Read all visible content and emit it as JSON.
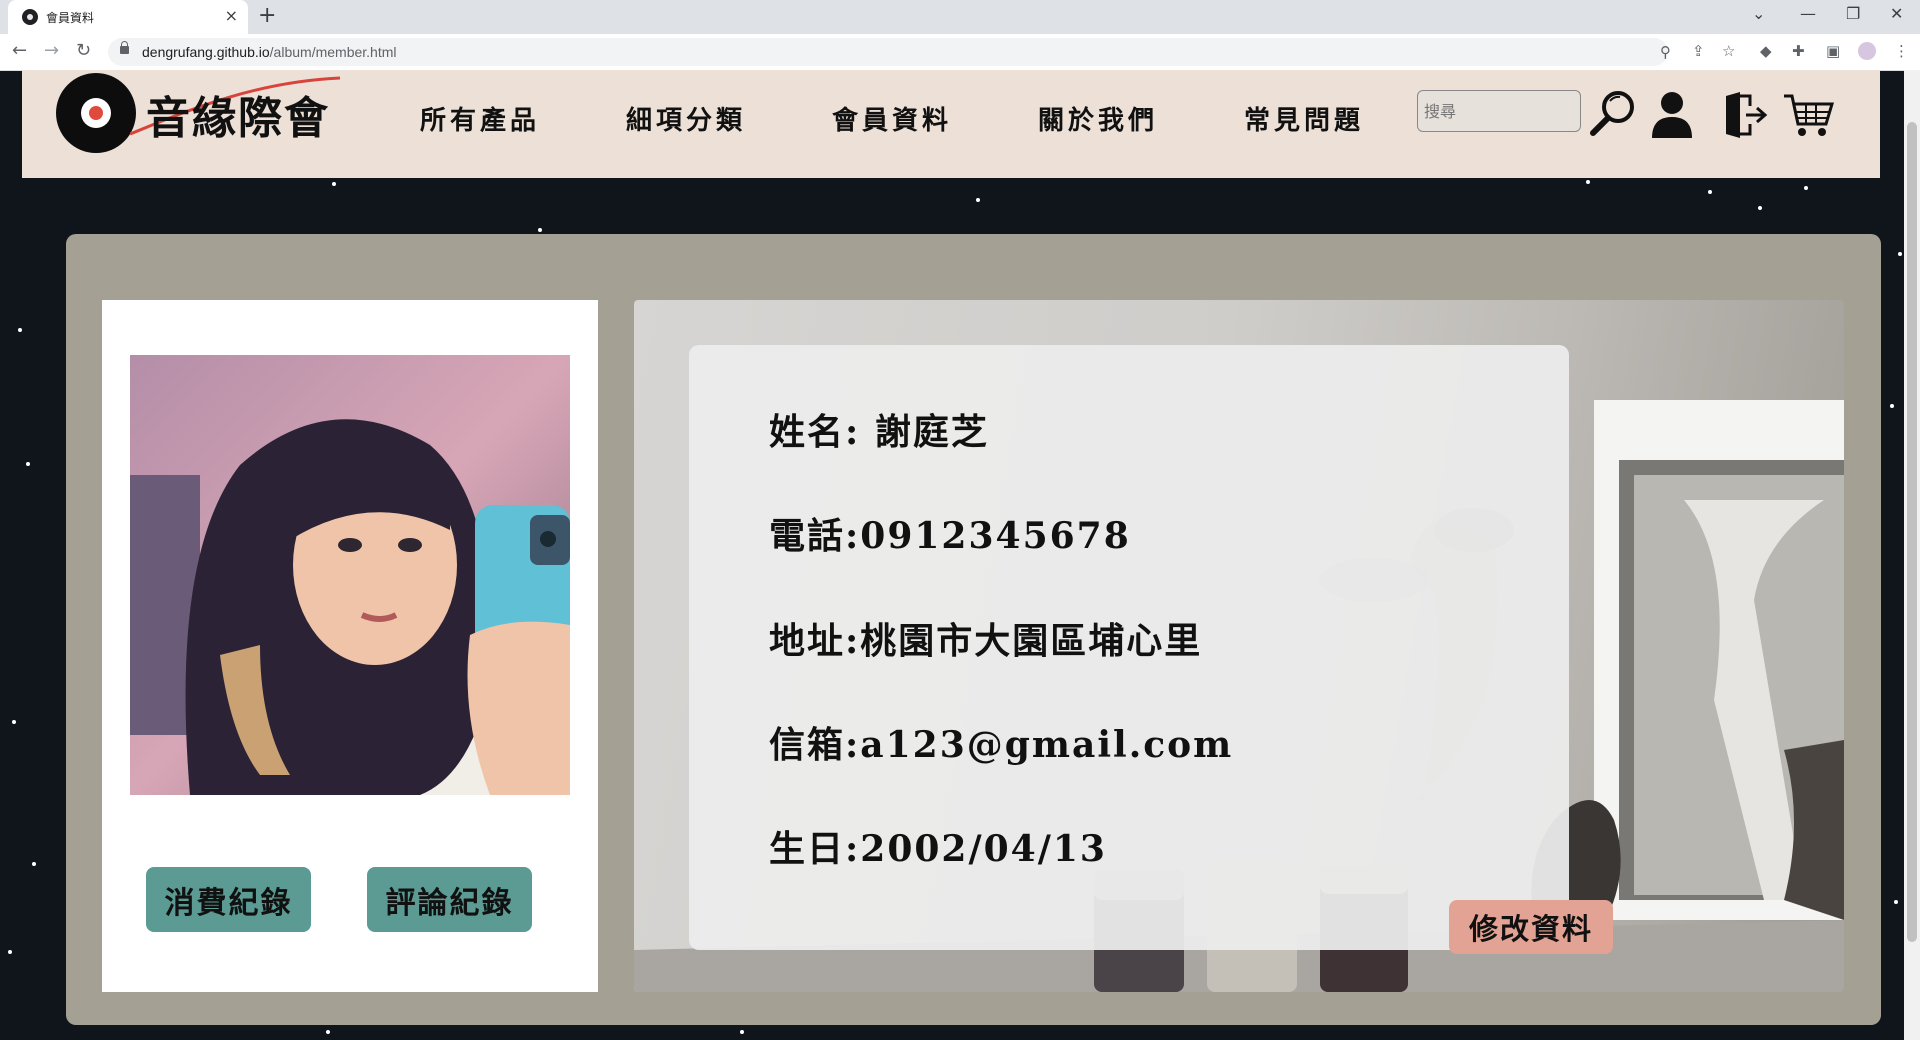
{
  "browser": {
    "tab_title": "會員資料",
    "tab_close": "×",
    "new_tab": "+",
    "url_host": "dengrufang.github.io",
    "url_path": "/album/member.html"
  },
  "header": {
    "logo_text": "音緣際會",
    "nav": [
      "所有產品",
      "細項分類",
      "會員資料",
      "關於我們",
      "常見問題"
    ],
    "search_placeholder": "搜尋"
  },
  "profile": {
    "buttons": {
      "purchase_history": "消費紀錄",
      "review_history": "評論紀錄"
    }
  },
  "member_info": {
    "name": "姓名: 謝庭芝",
    "phone": "電話:0912345678",
    "address": "地址:桃園市大園區埔心里",
    "email": "信箱:a123@gmail.com",
    "birthday": "生日:2002/04/13",
    "edit_button": "修改資料"
  },
  "colors": {
    "header_bg": "#ede0d7",
    "page_bg": "#10151c",
    "card_bg": "#a5a094",
    "teal_button": "#5b9b94",
    "edit_button": "#e3a394"
  },
  "icons": {
    "header": [
      "search-icon",
      "user-icon",
      "logout-icon",
      "cart-icon"
    ],
    "browser": [
      "back-icon",
      "forward-icon",
      "reload-icon",
      "lock-icon",
      "zoom-icon",
      "share-icon",
      "bookmark-star-icon",
      "extensions-icon",
      "side-panel-icon",
      "profile-icon",
      "menu-icon"
    ]
  }
}
